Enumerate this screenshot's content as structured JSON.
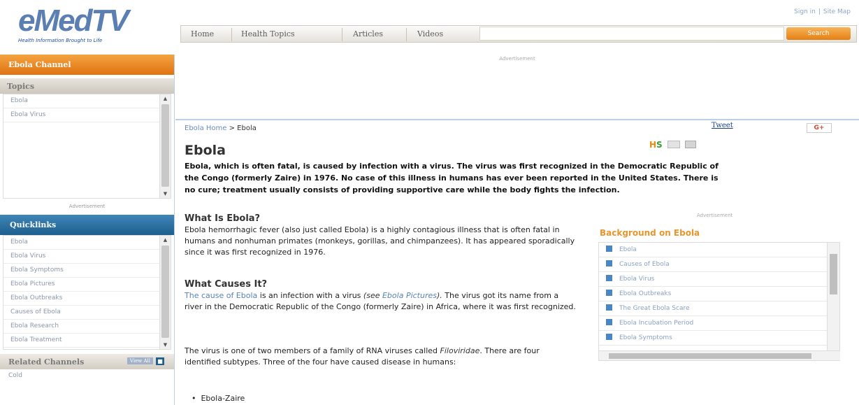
{
  "header": {
    "logo_text": "eMedTV",
    "tagline": "Health Information Brought to Life",
    "top_links": [
      "Sign in",
      "|",
      "Site Map"
    ],
    "nav": [
      "Home",
      "Health Topics",
      "Articles",
      "Videos"
    ],
    "search_placeholder": "",
    "search_button": "Search"
  },
  "sidebar": {
    "channel_title": "Ebola Channel",
    "topics_title": "Topics",
    "topics": [
      "Ebola",
      "Ebola Virus"
    ],
    "ad_label": "Advertisement",
    "quicklinks_title": "Quicklinks",
    "quicklinks": [
      "Ebola",
      "Ebola Virus",
      "Ebola Symptoms",
      "Ebola Pictures",
      "Ebola Outbreaks",
      "Causes of Ebola",
      "Ebola Research",
      "Ebola Treatment"
    ],
    "related_title": "Related Channels",
    "view_all": "View All",
    "related": [
      "Cold"
    ]
  },
  "ad_top_label": "Advertisement",
  "main": {
    "breadcrumb_link": "Ebola Home",
    "breadcrumb_sep": ">",
    "breadcrumb_current": "Ebola",
    "tweet": "Tweet",
    "gplus": "G+",
    "title": "Ebola",
    "intro": "Ebola, which is often fatal, is caused by infection with a virus. The virus was first recognized in the Democratic Republic of the Congo (formerly Zaire) in 1976. No case of this illness in humans has ever been reported in the United States. There is no cure; treatment usually consists of providing supportive care while the body fights the infection.",
    "section1_title": "What Is Ebola?",
    "section1_text": "Ebola hemorrhagic fever (also just called Ebola) is a highly contagious illness that is often fatal in humans and nonhuman primates (monkeys, gorillas, and chimpanzees). It has appeared sporadically since it was first recognized in 1976.",
    "section2_title": "What Causes It?",
    "section2_link": "The cause of Ebola",
    "section2_mid": " is an infection with a virus ",
    "section2_see": "(see ",
    "section2_see_link": "Ebola Pictures",
    "section2_see_end": ").",
    "section2_rest": " The virus got its name from a river in the Democratic Republic of the Congo (formerly Zaire) in Africa, where it was first recognized.",
    "section3_pre": "The virus is one of two members of a family of RNA viruses called ",
    "section3_italic": "Filoviridae",
    "section3_post": ". There are four identified subtypes. Three of the four have caused disease in humans:",
    "bullets": [
      "Ebola-Zaire"
    ]
  },
  "background": {
    "ad_label": "Advertisement",
    "title": "Background on Ebola",
    "items": [
      "Ebola",
      "Causes of Ebola",
      "Ebola Virus",
      "Ebola Outbreaks",
      "The Great Ebola Scare",
      "Ebola Incubation Period",
      "Ebola Symptoms"
    ]
  }
}
